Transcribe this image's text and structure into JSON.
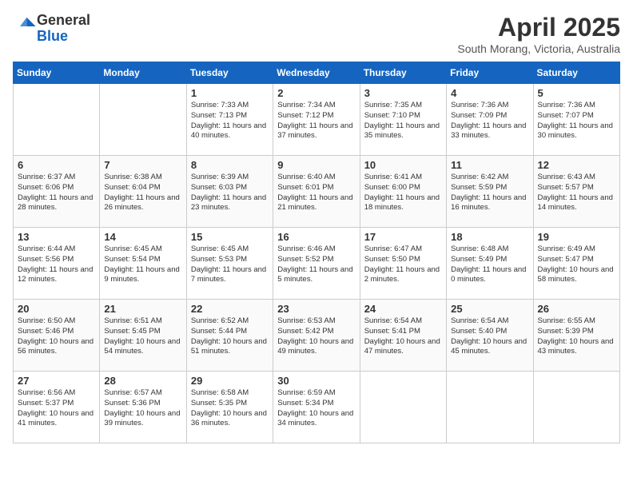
{
  "header": {
    "logo_general": "General",
    "logo_blue": "Blue",
    "month_title": "April 2025",
    "location": "South Morang, Victoria, Australia"
  },
  "days_of_week": [
    "Sunday",
    "Monday",
    "Tuesday",
    "Wednesday",
    "Thursday",
    "Friday",
    "Saturday"
  ],
  "weeks": [
    [
      {
        "day": "",
        "info": ""
      },
      {
        "day": "",
        "info": ""
      },
      {
        "day": "1",
        "info": "Sunrise: 7:33 AM\nSunset: 7:13 PM\nDaylight: 11 hours and 40 minutes."
      },
      {
        "day": "2",
        "info": "Sunrise: 7:34 AM\nSunset: 7:12 PM\nDaylight: 11 hours and 37 minutes."
      },
      {
        "day": "3",
        "info": "Sunrise: 7:35 AM\nSunset: 7:10 PM\nDaylight: 11 hours and 35 minutes."
      },
      {
        "day": "4",
        "info": "Sunrise: 7:36 AM\nSunset: 7:09 PM\nDaylight: 11 hours and 33 minutes."
      },
      {
        "day": "5",
        "info": "Sunrise: 7:36 AM\nSunset: 7:07 PM\nDaylight: 11 hours and 30 minutes."
      }
    ],
    [
      {
        "day": "6",
        "info": "Sunrise: 6:37 AM\nSunset: 6:06 PM\nDaylight: 11 hours and 28 minutes."
      },
      {
        "day": "7",
        "info": "Sunrise: 6:38 AM\nSunset: 6:04 PM\nDaylight: 11 hours and 26 minutes."
      },
      {
        "day": "8",
        "info": "Sunrise: 6:39 AM\nSunset: 6:03 PM\nDaylight: 11 hours and 23 minutes."
      },
      {
        "day": "9",
        "info": "Sunrise: 6:40 AM\nSunset: 6:01 PM\nDaylight: 11 hours and 21 minutes."
      },
      {
        "day": "10",
        "info": "Sunrise: 6:41 AM\nSunset: 6:00 PM\nDaylight: 11 hours and 18 minutes."
      },
      {
        "day": "11",
        "info": "Sunrise: 6:42 AM\nSunset: 5:59 PM\nDaylight: 11 hours and 16 minutes."
      },
      {
        "day": "12",
        "info": "Sunrise: 6:43 AM\nSunset: 5:57 PM\nDaylight: 11 hours and 14 minutes."
      }
    ],
    [
      {
        "day": "13",
        "info": "Sunrise: 6:44 AM\nSunset: 5:56 PM\nDaylight: 11 hours and 12 minutes."
      },
      {
        "day": "14",
        "info": "Sunrise: 6:45 AM\nSunset: 5:54 PM\nDaylight: 11 hours and 9 minutes."
      },
      {
        "day": "15",
        "info": "Sunrise: 6:45 AM\nSunset: 5:53 PM\nDaylight: 11 hours and 7 minutes."
      },
      {
        "day": "16",
        "info": "Sunrise: 6:46 AM\nSunset: 5:52 PM\nDaylight: 11 hours and 5 minutes."
      },
      {
        "day": "17",
        "info": "Sunrise: 6:47 AM\nSunset: 5:50 PM\nDaylight: 11 hours and 2 minutes."
      },
      {
        "day": "18",
        "info": "Sunrise: 6:48 AM\nSunset: 5:49 PM\nDaylight: 11 hours and 0 minutes."
      },
      {
        "day": "19",
        "info": "Sunrise: 6:49 AM\nSunset: 5:47 PM\nDaylight: 10 hours and 58 minutes."
      }
    ],
    [
      {
        "day": "20",
        "info": "Sunrise: 6:50 AM\nSunset: 5:46 PM\nDaylight: 10 hours and 56 minutes."
      },
      {
        "day": "21",
        "info": "Sunrise: 6:51 AM\nSunset: 5:45 PM\nDaylight: 10 hours and 54 minutes."
      },
      {
        "day": "22",
        "info": "Sunrise: 6:52 AM\nSunset: 5:44 PM\nDaylight: 10 hours and 51 minutes."
      },
      {
        "day": "23",
        "info": "Sunrise: 6:53 AM\nSunset: 5:42 PM\nDaylight: 10 hours and 49 minutes."
      },
      {
        "day": "24",
        "info": "Sunrise: 6:54 AM\nSunset: 5:41 PM\nDaylight: 10 hours and 47 minutes."
      },
      {
        "day": "25",
        "info": "Sunrise: 6:54 AM\nSunset: 5:40 PM\nDaylight: 10 hours and 45 minutes."
      },
      {
        "day": "26",
        "info": "Sunrise: 6:55 AM\nSunset: 5:39 PM\nDaylight: 10 hours and 43 minutes."
      }
    ],
    [
      {
        "day": "27",
        "info": "Sunrise: 6:56 AM\nSunset: 5:37 PM\nDaylight: 10 hours and 41 minutes."
      },
      {
        "day": "28",
        "info": "Sunrise: 6:57 AM\nSunset: 5:36 PM\nDaylight: 10 hours and 39 minutes."
      },
      {
        "day": "29",
        "info": "Sunrise: 6:58 AM\nSunset: 5:35 PM\nDaylight: 10 hours and 36 minutes."
      },
      {
        "day": "30",
        "info": "Sunrise: 6:59 AM\nSunset: 5:34 PM\nDaylight: 10 hours and 34 minutes."
      },
      {
        "day": "",
        "info": ""
      },
      {
        "day": "",
        "info": ""
      },
      {
        "day": "",
        "info": ""
      }
    ]
  ]
}
